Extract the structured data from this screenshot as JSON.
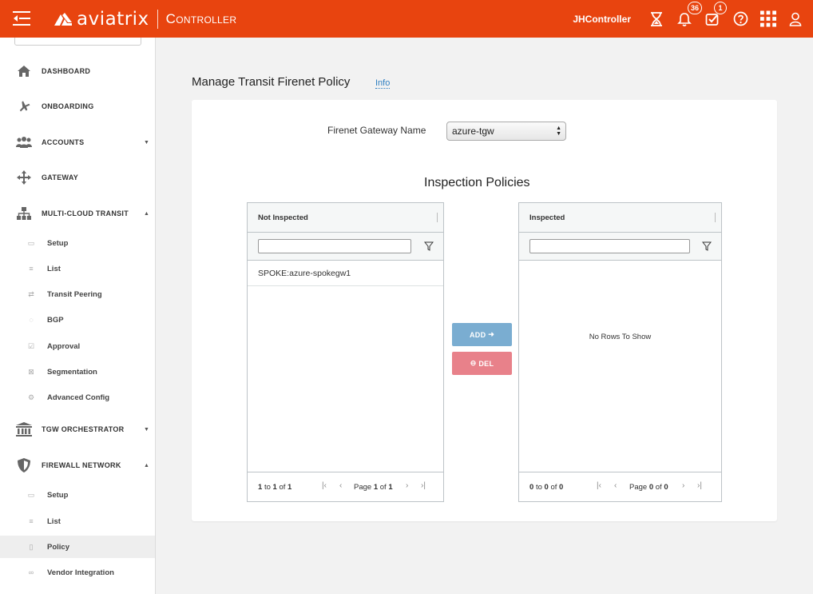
{
  "header": {
    "brand": "aviatrix",
    "product": "Controller",
    "controller_name": "JHController",
    "notifications_count": "36",
    "tasks_count": "1"
  },
  "sidebar": {
    "items": [
      {
        "label": "DASHBOARD",
        "icon": "home-icon"
      },
      {
        "label": "ONBOARDING",
        "icon": "plane-icon"
      },
      {
        "label": "ACCOUNTS",
        "icon": "users-icon"
      },
      {
        "label": "GATEWAY",
        "icon": "arrows-icon"
      },
      {
        "label": "MULTI-CLOUD TRANSIT",
        "icon": "network-icon"
      },
      {
        "label": "TGW ORCHESTRATOR",
        "icon": "building-icon"
      },
      {
        "label": "FIREWALL NETWORK",
        "icon": "shield-icon"
      }
    ],
    "transit_sub": [
      "Setup",
      "List",
      "Transit Peering",
      "BGP",
      "Approval",
      "Segmentation",
      "Advanced Config"
    ],
    "firewall_sub": [
      "Setup",
      "List",
      "Policy",
      "Vendor Integration"
    ]
  },
  "main": {
    "title": "Manage Transit Firenet Policy",
    "info": "Info",
    "gateway_label": "Firenet Gateway Name",
    "gateway_value": "azure-tgw",
    "section_title": "Inspection Policies",
    "left_grid": {
      "header": "Not Inspected",
      "rows": [
        "SPOKE:azure-spokegw1"
      ],
      "count_from": "1",
      "count_to": "1",
      "count_total": "1",
      "page": "1",
      "pages": "1"
    },
    "right_grid": {
      "header": "Inspected",
      "empty": "No Rows To Show",
      "count_from": "0",
      "count_to": "0",
      "count_total": "0",
      "page": "0",
      "pages": "0"
    },
    "add_label": "ADD",
    "del_label": "DEL",
    "pager": {
      "to": "to",
      "of": "of",
      "page": "Page"
    }
  }
}
